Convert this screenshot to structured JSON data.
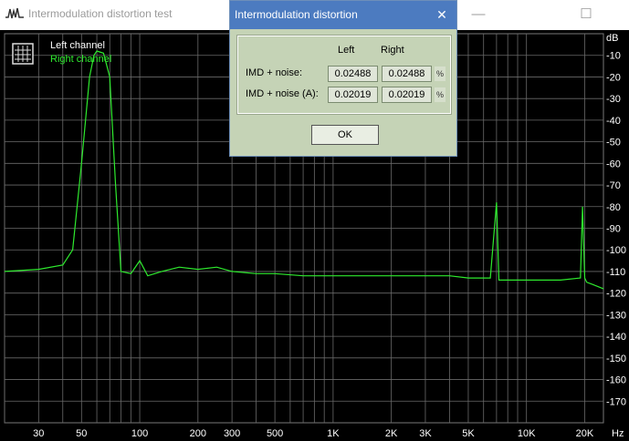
{
  "window": {
    "title": "Intermodulation distortion test",
    "minimize_glyph": "—",
    "maximize_glyph": "☐",
    "close_glyph": "✕"
  },
  "legend": {
    "left_label": "Left channel",
    "right_label": "Right channel",
    "left_color": "#ffffff",
    "right_color": "#2eea2e"
  },
  "dialog": {
    "title": "Intermodulation distortion",
    "close_glyph": "✕",
    "col_left": "Left",
    "col_right": "Right",
    "rows": [
      {
        "label": "IMD + noise:",
        "left": "0.02488",
        "right": "0.02488",
        "unit": "%"
      },
      {
        "label": "IMD + noise (A):",
        "left": "0.02019",
        "right": "0.02019",
        "unit": "%"
      }
    ],
    "ok_label": "OK"
  },
  "chart_data": {
    "type": "line",
    "x_scale": "log",
    "xlim": [
      20,
      25000
    ],
    "ylim": [
      -180,
      0
    ],
    "y_unit": "dB",
    "x_unit": "Hz",
    "x_ticks": [
      "30",
      "50",
      "100",
      "200",
      "300",
      "500",
      "1K",
      "2K",
      "3K",
      "5K",
      "10K",
      "20K"
    ],
    "x_tick_values": [
      30,
      50,
      100,
      200,
      300,
      500,
      1000,
      2000,
      3000,
      5000,
      10000,
      20000
    ],
    "y_ticks": [
      "-10",
      "-20",
      "-30",
      "-40",
      "-50",
      "-60",
      "-70",
      "-80",
      "-90",
      "-100",
      "-110",
      "-120",
      "-130",
      "-140",
      "-150",
      "-160",
      "-170"
    ],
    "y_tick_values": [
      -10,
      -20,
      -30,
      -40,
      -50,
      -60,
      -70,
      -80,
      -90,
      -100,
      -110,
      -120,
      -130,
      -140,
      -150,
      -160,
      -170
    ],
    "grid": true,
    "series": [
      {
        "name": "Right channel",
        "color": "#2eea2e",
        "x": [
          20,
          30,
          40,
          45,
          50,
          55,
          58,
          60,
          65,
          70,
          75,
          80,
          90,
          100,
          110,
          130,
          160,
          200,
          250,
          300,
          400,
          500,
          700,
          1000,
          1500,
          2000,
          3000,
          4000,
          5000,
          6500,
          7000,
          7200,
          7500,
          10000,
          15000,
          19000,
          19500,
          20000,
          20500,
          22000,
          25000
        ],
        "y": [
          -110,
          -109,
          -107,
          -100,
          -60,
          -20,
          -10,
          -8,
          -9,
          -20,
          -70,
          -110,
          -111,
          -105,
          -112,
          -110,
          -108,
          -109,
          -108,
          -110,
          -111,
          -111,
          -112,
          -112,
          -112,
          -112,
          -112,
          -112,
          -113,
          -113,
          -78,
          -114,
          -114,
          -114,
          -114,
          -113,
          -80,
          -113,
          -115,
          -116,
          -118
        ]
      }
    ]
  }
}
